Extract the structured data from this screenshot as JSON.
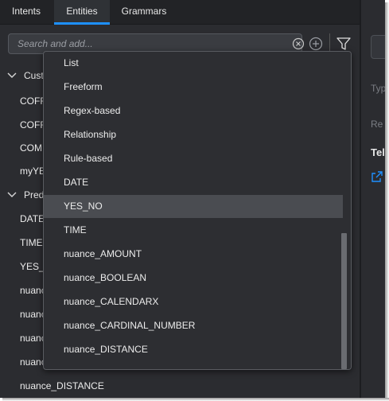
{
  "tabs": [
    {
      "label": "Intents"
    },
    {
      "label": "Entities"
    },
    {
      "label": "Grammars"
    }
  ],
  "search": {
    "placeholder": "Search and add..."
  },
  "tree": {
    "groups": [
      {
        "label": "Cust"
      },
      {
        "label": "Pred"
      }
    ],
    "custom_items": [
      "COFF",
      "COFF",
      "COMI",
      "myYE"
    ],
    "predefined_items": [
      "DATE",
      "TIME",
      "YES_I",
      "nuanc",
      "nuanc",
      "nuanc",
      "nuanc",
      "nuance_DISTANCE"
    ]
  },
  "dropdown": {
    "items": [
      {
        "label": "List"
      },
      {
        "label": "Freeform"
      },
      {
        "label": "Regex-based"
      },
      {
        "label": "Relationship"
      },
      {
        "label": "Rule-based"
      },
      {
        "label": "DATE"
      },
      {
        "label": "YES_NO"
      },
      {
        "label": "TIME"
      },
      {
        "label": "nuance_AMOUNT"
      },
      {
        "label": "nuance_BOOLEAN"
      },
      {
        "label": "nuance_CALENDARX"
      },
      {
        "label": "nuance_CARDINAL_NUMBER"
      },
      {
        "label": "nuance_DISTANCE"
      }
    ],
    "selected": "YES_NO"
  },
  "right_panel": {
    "label_1": "Typ",
    "label_2": "Re",
    "bold_label": "Tel"
  },
  "icons": {
    "search_clear": "clear-circle-icon",
    "add": "plus-circle-icon",
    "filter": "filter-funnel-icon",
    "expand": "chevron-down-icon",
    "external_link": "external-link-icon"
  },
  "colors": {
    "background": "#2b2c30",
    "tab_active_underline": "#1e90ff",
    "dropdown_selected": "#4a4c51",
    "link_blue": "#1e90ff"
  }
}
